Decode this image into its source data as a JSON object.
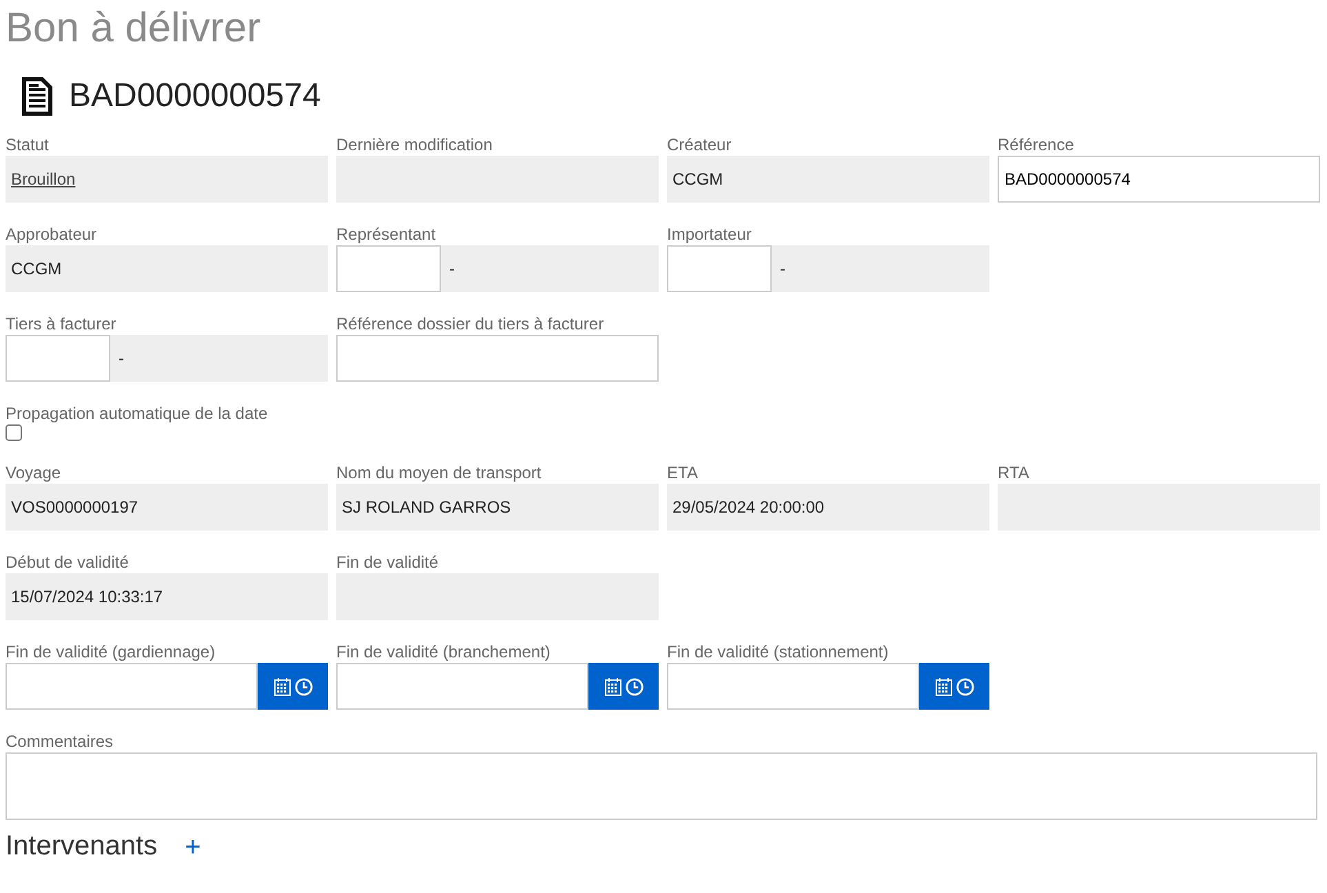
{
  "page_title": "Bon à délivrer",
  "document": {
    "number": "BAD0000000574"
  },
  "rows": [
    [
      {
        "label": "Statut",
        "kind": "link",
        "value": "Brouillon"
      },
      {
        "label": "Dernière modification",
        "kind": "readonly"
      },
      {
        "label": "Créateur",
        "kind": "readonly",
        "value": "CCGM"
      },
      {
        "label": "Référence",
        "kind": "input",
        "value": "BAD0000000574"
      }
    ],
    [
      {
        "label": "Approbateur",
        "kind": "readonly",
        "value": "CCGM"
      },
      {
        "label": "Représentant",
        "kind": "lookup",
        "value": "-"
      },
      {
        "label": "Importateur",
        "kind": "lookup",
        "value": "-"
      }
    ],
    [
      {
        "label": "Tiers à facturer",
        "kind": "lookup",
        "value": "-"
      },
      {
        "label": "Référence dossier du tiers à facturer",
        "kind": "input"
      }
    ],
    [
      {
        "label": "Propagation automatique de la date",
        "kind": "checkbox",
        "checked": false
      }
    ],
    [
      {
        "label": "Voyage",
        "kind": "readonly",
        "value": "VOS0000000197"
      },
      {
        "label": "Nom du moyen de transport",
        "kind": "readonly",
        "value": "SJ ROLAND GARROS"
      },
      {
        "label": "ETA",
        "kind": "readonly",
        "value": "29/05/2024 20:00:00"
      },
      {
        "label": "RTA",
        "kind": "readonly"
      }
    ],
    [
      {
        "label": "Début de validité",
        "kind": "readonly",
        "value": "15/07/2024 10:33:17"
      },
      {
        "label": "Fin de validité",
        "kind": "readonly"
      }
    ],
    [
      {
        "label": "Fin de validité (gardiennage)",
        "kind": "datetime"
      },
      {
        "label": "Fin de validité (branchement)",
        "kind": "datetime"
      },
      {
        "label": "Fin de validité (stationnement)",
        "kind": "datetime"
      }
    ],
    [
      {
        "label": "Commentaires",
        "kind": "textarea"
      }
    ]
  ],
  "section": {
    "title": "Intervenants",
    "add": "+"
  }
}
